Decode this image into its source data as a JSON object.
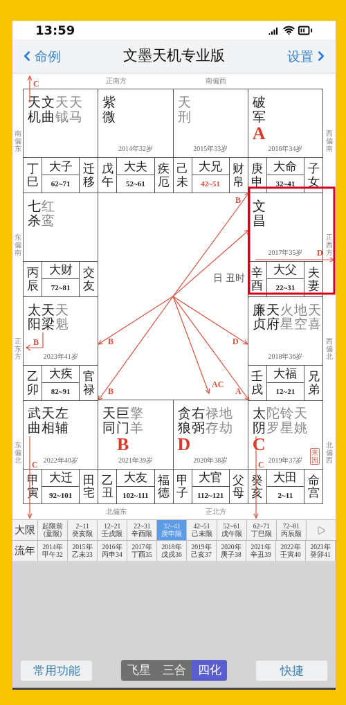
{
  "status_bar": {
    "time": "13:59"
  },
  "nav": {
    "back": "命例",
    "title": "文墨天机专业版",
    "forward": "设置"
  },
  "directions": {
    "top": [
      "正南方",
      "南偏西"
    ],
    "bottom": [
      "北偏东",
      "正北方"
    ],
    "left": [
      "南偏东",
      "东偏南",
      "正东方",
      "东偏北"
    ],
    "right": [
      "西偏南",
      "正西方",
      "西偏北",
      "北偏西"
    ]
  },
  "palaces": [
    {
      "stars": [
        {
          "text": "天机",
          "kind": "main"
        },
        {
          "text": "文曲",
          "kind": "main"
        },
        {
          "text": "天钺",
          "kind": "minor"
        },
        {
          "text": "天马",
          "kind": "minor"
        }
      ],
      "stem": "丁巳",
      "decade": "大子",
      "range": "62~71",
      "range_highlighted": false,
      "palace": "迁移"
    },
    {
      "stars": [
        {
          "text": "紫微",
          "kind": "main"
        }
      ],
      "year": "2014年32岁",
      "stem": "戊午",
      "decade": "大夫",
      "range": "52~61",
      "range_highlighted": false,
      "palace": "疾厄"
    },
    {
      "stars": [
        {
          "text": "天刑",
          "kind": "minor"
        }
      ],
      "year": "2015年33岁",
      "stem": "己未",
      "decade": "大兄",
      "range": "42~51",
      "range_highlighted": true,
      "palace": "财帛"
    },
    {
      "stars": [
        {
          "text": "破军",
          "kind": "main",
          "mutagen": "A"
        }
      ],
      "year": "2016年34岁",
      "stem": "庚申",
      "decade": "大命",
      "range": "32~41",
      "range_highlighted": false,
      "palace": "子女"
    },
    {
      "stars": [
        {
          "text": "七杀",
          "kind": "main"
        },
        {
          "text": "红鸾",
          "kind": "minor"
        }
      ],
      "stem": "丙辰",
      "decade": "大财",
      "range": "72~81",
      "range_highlighted": false,
      "palace": "交友"
    },
    {
      "stars": [
        {
          "text": "文昌",
          "kind": "main"
        }
      ],
      "year": "2017年35岁",
      "stem": "辛酉",
      "decade": "大父",
      "range": "22~31",
      "range_highlighted": false,
      "palace": "夫妻"
    },
    {
      "stars": [
        {
          "text": "太阳",
          "kind": "main"
        },
        {
          "text": "天梁",
          "kind": "main"
        },
        {
          "text": "天魁",
          "kind": "minor"
        }
      ],
      "year": "2023年41岁",
      "stem": "乙卯",
      "decade": "大疾",
      "range": "82~91",
      "range_highlighted": false,
      "palace": "官禄"
    },
    {
      "stars": [
        {
          "text": "廉贞",
          "kind": "main"
        },
        {
          "text": "天府",
          "kind": "main"
        },
        {
          "text": "火星",
          "kind": "minor"
        },
        {
          "text": "地空",
          "kind": "minor"
        },
        {
          "text": "天喜",
          "kind": "minor"
        }
      ],
      "year": "2018年36岁",
      "stem": "壬戌",
      "decade": "大福",
      "range": "12~21",
      "range_highlighted": false,
      "palace": "兄弟"
    },
    {
      "stars": [
        {
          "text": "武曲",
          "kind": "main"
        },
        {
          "text": "天相",
          "kind": "main"
        },
        {
          "text": "左辅",
          "kind": "main"
        }
      ],
      "year": "2022年40岁",
      "stem": "甲寅",
      "decade": "大迁",
      "range": "92~101",
      "range_highlighted": false,
      "palace": "田宅"
    },
    {
      "stars": [
        {
          "text": "天同",
          "kind": "main"
        },
        {
          "text": "巨门",
          "kind": "main",
          "mutagen": "B"
        },
        {
          "text": "擎羊",
          "kind": "minor"
        }
      ],
      "year": "2021年39岁",
      "stem": "乙丑",
      "decade": "大友",
      "range": "102~111",
      "range_highlighted": false,
      "palace": "福德"
    },
    {
      "stars": [
        {
          "text": "贪狼",
          "kind": "main",
          "mutagen": "D"
        },
        {
          "text": "右弼",
          "kind": "main"
        },
        {
          "text": "禄存",
          "kind": "minor"
        },
        {
          "text": "地劫",
          "kind": "minor"
        }
      ],
      "year": "2020年38岁",
      "stem": "甲子",
      "decade": "大官",
      "range": "112~121",
      "range_highlighted": false,
      "palace": "父母"
    },
    {
      "stars": [
        {
          "text": "太阴",
          "kind": "main",
          "mutagen": "C"
        },
        {
          "text": "陀罗",
          "kind": "minor"
        },
        {
          "text": "铃星",
          "kind": "minor"
        },
        {
          "text": "天姚",
          "kind": "minor"
        }
      ],
      "year": "2019年37岁",
      "stem": "癸亥",
      "decade": "大田",
      "range": "2~11",
      "range_highlighted": false,
      "palace": "命宫",
      "stamp": "来因"
    }
  ],
  "center": {
    "text": "日 丑时",
    "arrow_labels": [
      "B",
      "B",
      "B",
      "D",
      "AC",
      "A"
    ]
  },
  "edge_labels": [
    "C",
    "C",
    "C",
    "D",
    "B"
  ],
  "decade_table": {
    "header": "大限",
    "cells": [
      {
        "lines": [
          "起限前",
          "(童限)"
        ],
        "selected": false
      },
      {
        "lines": [
          "2~11",
          "癸亥限"
        ],
        "selected": false
      },
      {
        "lines": [
          "12~21",
          "壬戌限"
        ],
        "selected": false
      },
      {
        "lines": [
          "22~31",
          "辛酉限"
        ],
        "selected": false
      },
      {
        "lines": [
          "32~41",
          "庚申限"
        ],
        "selected": true
      },
      {
        "lines": [
          "42~51",
          "己未限"
        ],
        "selected": false
      },
      {
        "lines": [
          "52~61",
          "戊午限"
        ],
        "selected": false
      },
      {
        "lines": [
          "62~71",
          "丁巳限"
        ],
        "selected": false
      },
      {
        "lines": [
          "72~81",
          "丙辰限"
        ],
        "selected": false
      }
    ]
  },
  "year_table": {
    "header": "流年",
    "cells": [
      {
        "lines": [
          "2014年",
          "甲午32"
        ],
        "selected": false
      },
      {
        "lines": [
          "2015年",
          "乙未33"
        ],
        "selected": false
      },
      {
        "lines": [
          "2016年",
          "丙申34"
        ],
        "selected": false
      },
      {
        "lines": [
          "2017年",
          "丁酉35"
        ],
        "selected": false
      },
      {
        "lines": [
          "2018年",
          "戊戌36"
        ],
        "selected": false
      },
      {
        "lines": [
          "2019年",
          "己亥37"
        ],
        "selected": false
      },
      {
        "lines": [
          "2020年",
          "庚子38"
        ],
        "selected": false
      },
      {
        "lines": [
          "2021年",
          "辛丑39"
        ],
        "selected": false
      },
      {
        "lines": [
          "2022年",
          "壬寅40"
        ],
        "selected": false
      },
      {
        "lines": [
          "2023年",
          "癸卯41"
        ],
        "selected": false
      }
    ]
  },
  "bottom": {
    "left": "常用功能",
    "segments": [
      {
        "label": "飞星",
        "selected": false
      },
      {
        "label": "三合",
        "selected": false
      },
      {
        "label": "四化",
        "selected": true
      }
    ],
    "right": "快捷"
  }
}
